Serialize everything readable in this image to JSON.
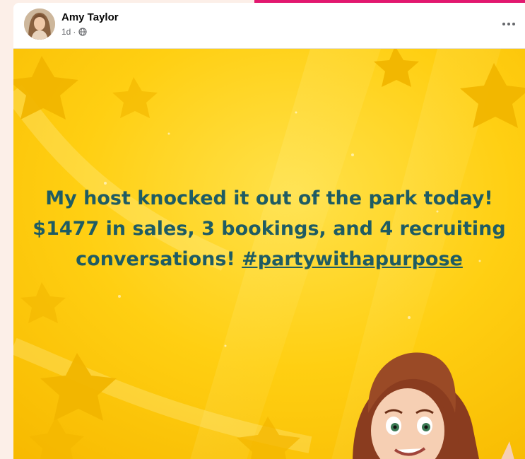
{
  "post": {
    "author": "Amy Taylor",
    "time": "1d",
    "separator": "·",
    "privacy_icon": "globe-icon",
    "menu_icon": "more-options-icon",
    "text_main": "My host knocked it out of the park today! $1477 in sales, 3 bookings, and 4 recruiting conversations! ",
    "hashtag": "#partywithapurpose"
  },
  "colors": {
    "background_yellow": "#ffcc10",
    "text_teal": "#1f5c63",
    "accent_pink": "#e2186f"
  }
}
